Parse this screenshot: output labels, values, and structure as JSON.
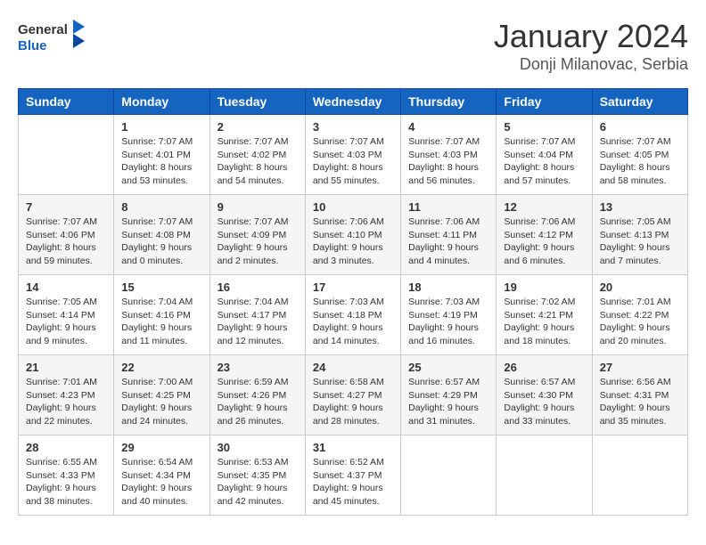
{
  "logo": {
    "text_general": "General",
    "text_blue": "Blue"
  },
  "title": "January 2024",
  "subtitle": "Donji Milanovac, Serbia",
  "weekdays": [
    "Sunday",
    "Monday",
    "Tuesday",
    "Wednesday",
    "Thursday",
    "Friday",
    "Saturday"
  ],
  "weeks": [
    [
      {
        "day": "",
        "info": ""
      },
      {
        "day": "1",
        "info": "Sunrise: 7:07 AM\nSunset: 4:01 PM\nDaylight: 8 hours\nand 53 minutes."
      },
      {
        "day": "2",
        "info": "Sunrise: 7:07 AM\nSunset: 4:02 PM\nDaylight: 8 hours\nand 54 minutes."
      },
      {
        "day": "3",
        "info": "Sunrise: 7:07 AM\nSunset: 4:03 PM\nDaylight: 8 hours\nand 55 minutes."
      },
      {
        "day": "4",
        "info": "Sunrise: 7:07 AM\nSunset: 4:03 PM\nDaylight: 8 hours\nand 56 minutes."
      },
      {
        "day": "5",
        "info": "Sunrise: 7:07 AM\nSunset: 4:04 PM\nDaylight: 8 hours\nand 57 minutes."
      },
      {
        "day": "6",
        "info": "Sunrise: 7:07 AM\nSunset: 4:05 PM\nDaylight: 8 hours\nand 58 minutes."
      }
    ],
    [
      {
        "day": "7",
        "info": "Sunrise: 7:07 AM\nSunset: 4:06 PM\nDaylight: 8 hours\nand 59 minutes."
      },
      {
        "day": "8",
        "info": "Sunrise: 7:07 AM\nSunset: 4:08 PM\nDaylight: 9 hours\nand 0 minutes."
      },
      {
        "day": "9",
        "info": "Sunrise: 7:07 AM\nSunset: 4:09 PM\nDaylight: 9 hours\nand 2 minutes."
      },
      {
        "day": "10",
        "info": "Sunrise: 7:06 AM\nSunset: 4:10 PM\nDaylight: 9 hours\nand 3 minutes."
      },
      {
        "day": "11",
        "info": "Sunrise: 7:06 AM\nSunset: 4:11 PM\nDaylight: 9 hours\nand 4 minutes."
      },
      {
        "day": "12",
        "info": "Sunrise: 7:06 AM\nSunset: 4:12 PM\nDaylight: 9 hours\nand 6 minutes."
      },
      {
        "day": "13",
        "info": "Sunrise: 7:05 AM\nSunset: 4:13 PM\nDaylight: 9 hours\nand 7 minutes."
      }
    ],
    [
      {
        "day": "14",
        "info": "Sunrise: 7:05 AM\nSunset: 4:14 PM\nDaylight: 9 hours\nand 9 minutes."
      },
      {
        "day": "15",
        "info": "Sunrise: 7:04 AM\nSunset: 4:16 PM\nDaylight: 9 hours\nand 11 minutes."
      },
      {
        "day": "16",
        "info": "Sunrise: 7:04 AM\nSunset: 4:17 PM\nDaylight: 9 hours\nand 12 minutes."
      },
      {
        "day": "17",
        "info": "Sunrise: 7:03 AM\nSunset: 4:18 PM\nDaylight: 9 hours\nand 14 minutes."
      },
      {
        "day": "18",
        "info": "Sunrise: 7:03 AM\nSunset: 4:19 PM\nDaylight: 9 hours\nand 16 minutes."
      },
      {
        "day": "19",
        "info": "Sunrise: 7:02 AM\nSunset: 4:21 PM\nDaylight: 9 hours\nand 18 minutes."
      },
      {
        "day": "20",
        "info": "Sunrise: 7:01 AM\nSunset: 4:22 PM\nDaylight: 9 hours\nand 20 minutes."
      }
    ],
    [
      {
        "day": "21",
        "info": "Sunrise: 7:01 AM\nSunset: 4:23 PM\nDaylight: 9 hours\nand 22 minutes."
      },
      {
        "day": "22",
        "info": "Sunrise: 7:00 AM\nSunset: 4:25 PM\nDaylight: 9 hours\nand 24 minutes."
      },
      {
        "day": "23",
        "info": "Sunrise: 6:59 AM\nSunset: 4:26 PM\nDaylight: 9 hours\nand 26 minutes."
      },
      {
        "day": "24",
        "info": "Sunrise: 6:58 AM\nSunset: 4:27 PM\nDaylight: 9 hours\nand 28 minutes."
      },
      {
        "day": "25",
        "info": "Sunrise: 6:57 AM\nSunset: 4:29 PM\nDaylight: 9 hours\nand 31 minutes."
      },
      {
        "day": "26",
        "info": "Sunrise: 6:57 AM\nSunset: 4:30 PM\nDaylight: 9 hours\nand 33 minutes."
      },
      {
        "day": "27",
        "info": "Sunrise: 6:56 AM\nSunset: 4:31 PM\nDaylight: 9 hours\nand 35 minutes."
      }
    ],
    [
      {
        "day": "28",
        "info": "Sunrise: 6:55 AM\nSunset: 4:33 PM\nDaylight: 9 hours\nand 38 minutes."
      },
      {
        "day": "29",
        "info": "Sunrise: 6:54 AM\nSunset: 4:34 PM\nDaylight: 9 hours\nand 40 minutes."
      },
      {
        "day": "30",
        "info": "Sunrise: 6:53 AM\nSunset: 4:35 PM\nDaylight: 9 hours\nand 42 minutes."
      },
      {
        "day": "31",
        "info": "Sunrise: 6:52 AM\nSunset: 4:37 PM\nDaylight: 9 hours\nand 45 minutes."
      },
      {
        "day": "",
        "info": ""
      },
      {
        "day": "",
        "info": ""
      },
      {
        "day": "",
        "info": ""
      }
    ]
  ]
}
